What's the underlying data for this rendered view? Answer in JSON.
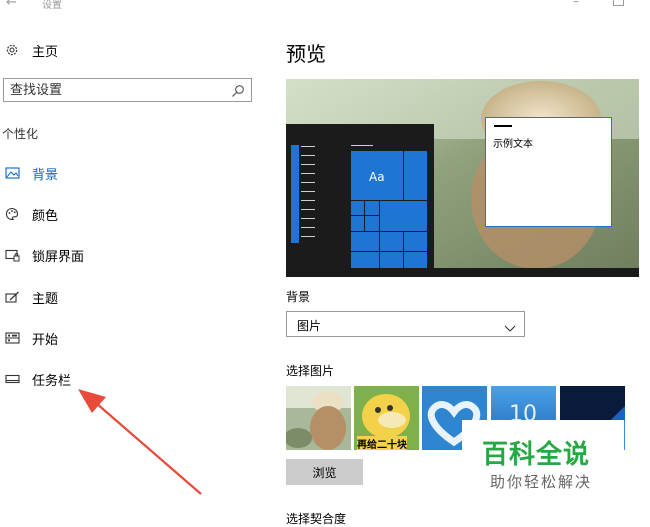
{
  "window": {
    "back_glyph": "←",
    "title": "设置",
    "minimize_glyph": "–"
  },
  "sidebar": {
    "home": "主页",
    "search": {
      "placeholder": "查找设置",
      "value": ""
    },
    "section_title": "个性化",
    "items": [
      {
        "label": "背景",
        "icon": "picture-icon",
        "active": true
      },
      {
        "label": "颜色",
        "icon": "palette-icon",
        "active": false
      },
      {
        "label": "锁屏界面",
        "icon": "lock-screen-icon",
        "active": false
      },
      {
        "label": "主题",
        "icon": "theme-brush-icon",
        "active": false
      },
      {
        "label": "开始",
        "icon": "start-menu-icon",
        "active": false
      },
      {
        "label": "任务栏",
        "icon": "taskbar-icon",
        "active": false
      }
    ]
  },
  "main": {
    "title": "预览",
    "preview": {
      "tile_label": "Aa",
      "sample_text": "示例文本"
    },
    "background_label": "背景",
    "background_select": {
      "value": "图片"
    },
    "choose_picture_label": "选择图片",
    "thumbnails": [
      {
        "name": "girl-with-hat"
      },
      {
        "name": "cartoon-duck",
        "caption": "再给二十块"
      },
      {
        "name": "clouds-heart"
      },
      {
        "name": "windows-10",
        "text": "10"
      },
      {
        "name": "windows-light"
      }
    ],
    "browse_button": "浏览",
    "fit_label": "选择契合度"
  },
  "watermark": {
    "main": "百科全说",
    "sub": "助你轻松解决"
  },
  "colors": {
    "accent": "#0a63c9",
    "tile_blue": "#1e75d3",
    "arrow_red": "#e84b3a",
    "watermark_green": "#27a844"
  }
}
